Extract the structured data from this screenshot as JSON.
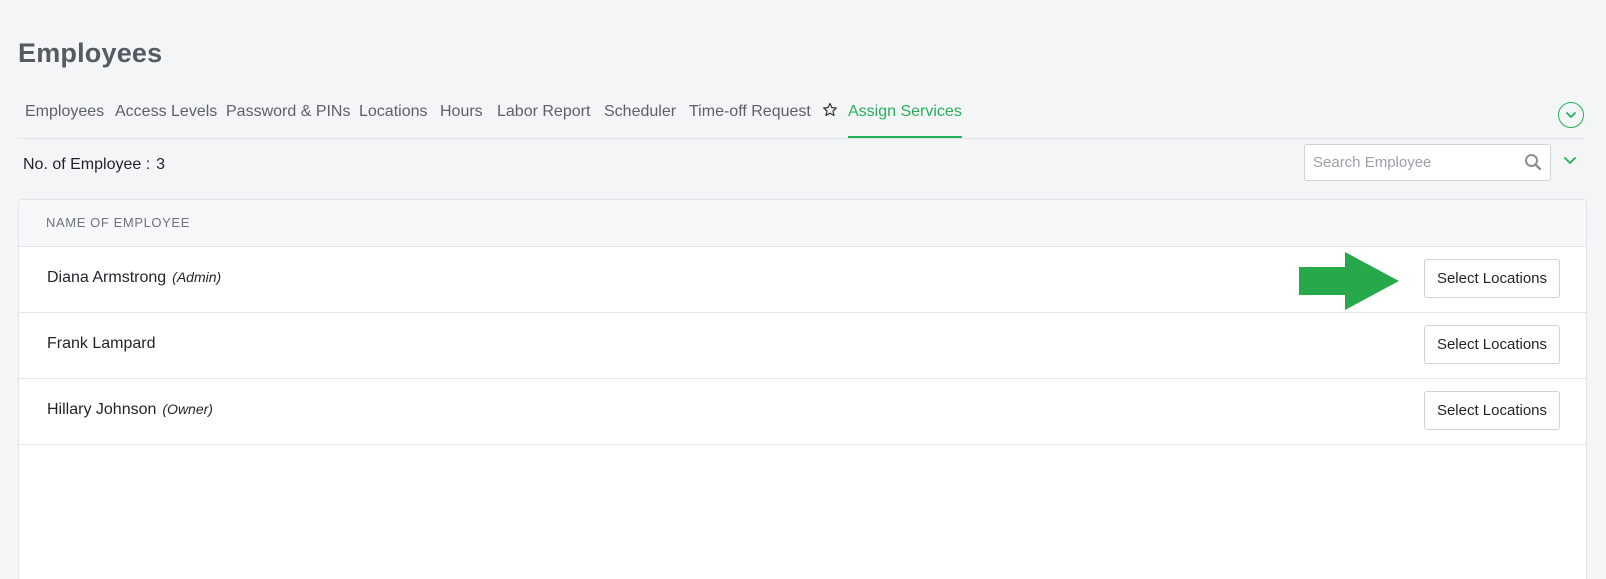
{
  "page": {
    "title": "Employees"
  },
  "tabs": [
    {
      "label": "Employees",
      "active": false
    },
    {
      "label": "Access Levels",
      "active": false
    },
    {
      "label": "Password & PINs",
      "active": false
    },
    {
      "label": "Locations",
      "active": false
    },
    {
      "label": "Hours",
      "active": false
    },
    {
      "label": "Labor Report",
      "active": false
    },
    {
      "label": "Scheduler",
      "active": false
    },
    {
      "label": "Time-off Request",
      "active": false
    },
    {
      "label": "Assign Services",
      "active": true
    }
  ],
  "summary": {
    "count_label": "No. of Employee :",
    "count_value": "3"
  },
  "search": {
    "placeholder": "Search Employee",
    "value": ""
  },
  "table": {
    "column_header": "NAME OF EMPLOYEE",
    "rows": [
      {
        "name": "Diana Armstrong",
        "role": "(Admin)",
        "action": "Select Locations"
      },
      {
        "name": "Frank Lampard",
        "role": "",
        "action": "Select Locations"
      },
      {
        "name": "Hillary Johnson",
        "role": "(Owner)",
        "action": "Select Locations"
      }
    ]
  },
  "icons": {
    "tab_star": "star-outline-icon",
    "collapse": "chevron-down-circle-icon",
    "search": "search-icon",
    "filter": "chevron-down-icon",
    "pointer": "green-arrow-right"
  },
  "colors": {
    "accent": "#25b15a",
    "arrow": "#27a84a"
  }
}
